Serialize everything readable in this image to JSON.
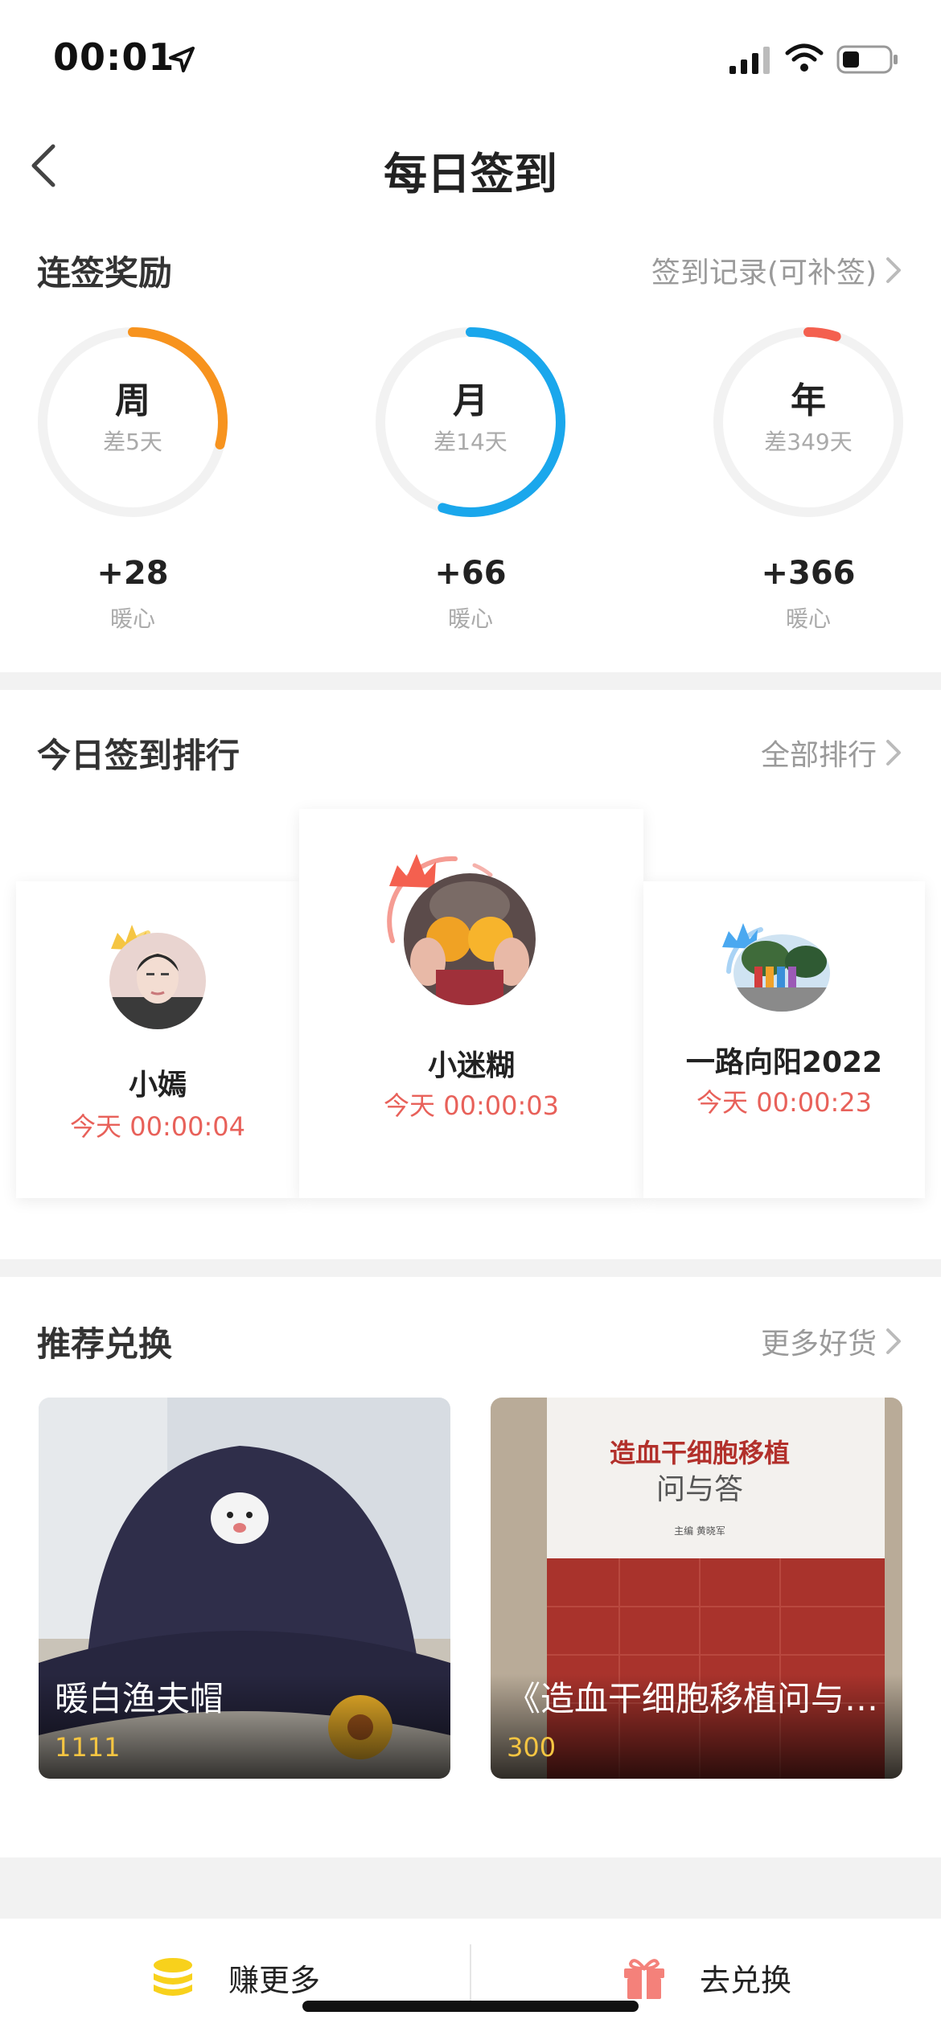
{
  "status_bar": {
    "time": "00:01"
  },
  "nav": {
    "title": "每日签到"
  },
  "streak": {
    "title": "连签奖励",
    "link": "签到记录(可补签)",
    "rings": [
      {
        "label": "周",
        "sub": "差5天",
        "points": "+28",
        "unit": "暖心",
        "color": "#f7931e",
        "progress": 0.29
      },
      {
        "label": "月",
        "sub": "差14天",
        "points": "+66",
        "unit": "暖心",
        "color": "#1aa7ec",
        "progress": 0.55
      },
      {
        "label": "年",
        "sub": "差349天",
        "points": "+366",
        "unit": "暖心",
        "color": "#f4604f",
        "progress": 0.05
      }
    ]
  },
  "ranking": {
    "title": "今日签到排行",
    "link": "全部排行",
    "entries": [
      {
        "rank": 2,
        "name": "小嫣",
        "time": "今天 00:00:04",
        "crown_color": "#f5c542"
      },
      {
        "rank": 1,
        "name": "小迷糊",
        "time": "今天 00:00:03",
        "crown_color": "#f4604f"
      },
      {
        "rank": 3,
        "name": "一路向阳2022",
        "time": "今天 00:00:23",
        "crown_color": "#4aa8f0"
      }
    ]
  },
  "exchange": {
    "title": "推荐兑换",
    "link": "更多好货",
    "products": [
      {
        "name": "暖白渔夫帽",
        "price": "1111"
      },
      {
        "name": "《造血干细胞移植问与答》",
        "price": "300",
        "cover_title": "造血干细胞移植",
        "cover_subtitle": "问与答",
        "cover_editor": "主编 黄晓军"
      }
    ]
  },
  "bottom_bar": {
    "earn_label": "赚更多",
    "redeem_label": "去兑换"
  }
}
